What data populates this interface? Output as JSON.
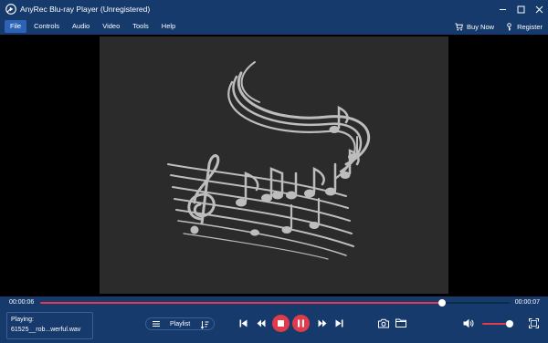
{
  "window": {
    "title": "AnyRec Blu-ray Player (Unregistered)"
  },
  "menu": {
    "items": [
      {
        "label": "File",
        "active": true
      },
      {
        "label": "Controls"
      },
      {
        "label": "Audio"
      },
      {
        "label": "Video"
      },
      {
        "label": "Tools"
      },
      {
        "label": "Help"
      }
    ],
    "buy_now": "Buy Now",
    "register": "Register"
  },
  "player": {
    "current_time": "00:00:06",
    "total_time": "00:00:07",
    "progress_fraction": 0.857,
    "volume_fraction": 0.85,
    "now_playing_label": "Playing:",
    "now_playing_file": "61525__rob...werful.wav",
    "playlist_label": "Playlist"
  },
  "colors": {
    "chrome": "#153a6b",
    "accent": "#e03a4b",
    "menu_active": "#2d63b6",
    "artwork_bg": "#2b2b2b"
  },
  "icons": {
    "logo": "anyrec-logo-icon",
    "buy": "cart-icon",
    "register": "key-icon",
    "playlist": "list-icon",
    "sort": "sort-icon",
    "prev": "skip-previous-icon",
    "rewind": "rewind-icon",
    "stop": "stop-icon",
    "pause": "pause-icon",
    "fast_forward": "fast-forward-icon",
    "next": "skip-next-icon",
    "snapshot": "camera-icon",
    "folder": "folder-icon",
    "volume": "volume-icon",
    "fullscreen": "fullscreen-icon"
  }
}
